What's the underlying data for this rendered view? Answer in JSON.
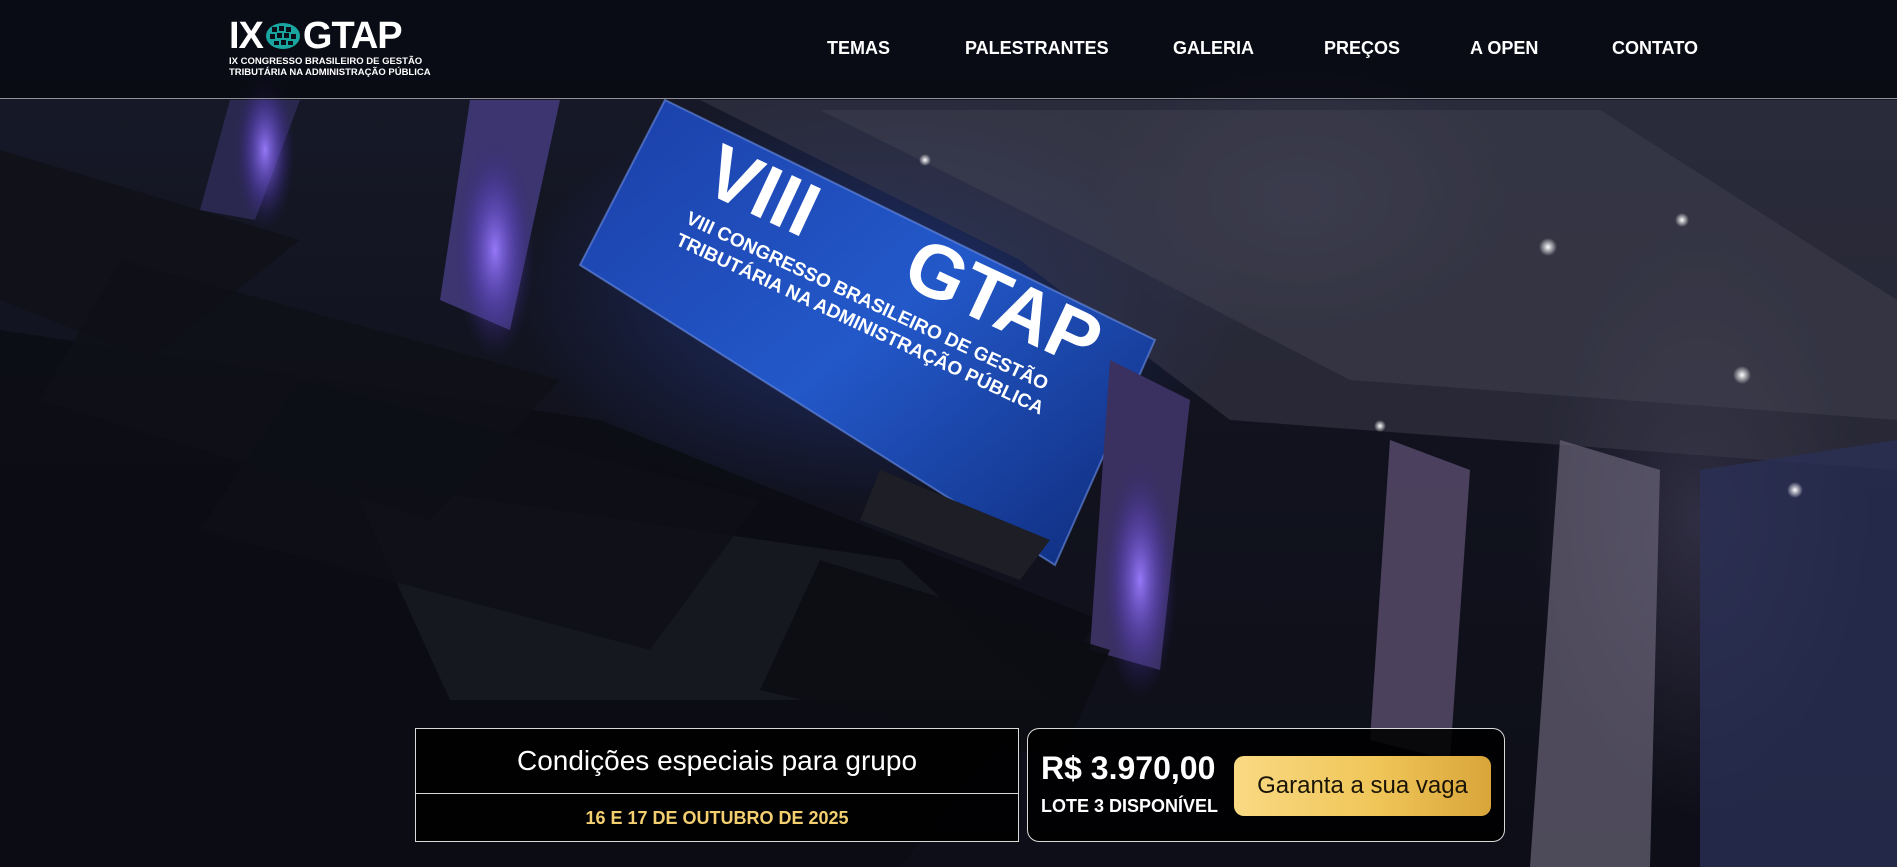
{
  "brand": {
    "logo_main_left": "IX",
    "logo_main_right": "GTAP",
    "logo_subtitle_line1": "IX CONGRESSO BRASILEIRO DE GESTÃO",
    "logo_subtitle_line2": "TRIBUTÁRIA NA ADMINISTRAÇÃO PÚBLICA"
  },
  "nav": {
    "items": [
      {
        "label": "TEMAS"
      },
      {
        "label": "PALESTRANTES"
      },
      {
        "label": "GALERIA"
      },
      {
        "label": "PREÇOS"
      },
      {
        "label": "A OPEN"
      },
      {
        "label": "CONTATO"
      }
    ]
  },
  "hero": {
    "background_description_icon": "conference-hall-photo",
    "screen_line1": "VIII",
    "screen_line2": "GTAP",
    "screen_line3": "VIII CONGRESSO BRASILEIRO DE GESTÃO",
    "screen_line4": "TRIBUTÁRIA NA ADMINISTRAÇÃO PÚBLICA"
  },
  "offer": {
    "group_title": "Condições especiais para grupo",
    "dates": "16 E 17 DE OUTUBRO DE 2025",
    "price": "R$ 3.970,00",
    "lot": "LOTE 3 DISPONÍVEL",
    "cta_label": "Garanta a sua vaga"
  },
  "colors": {
    "accent_gold": "#f0c659",
    "dates_gold": "#f3cf70",
    "header_bg": "#06070e",
    "box_bg": "#000000"
  }
}
